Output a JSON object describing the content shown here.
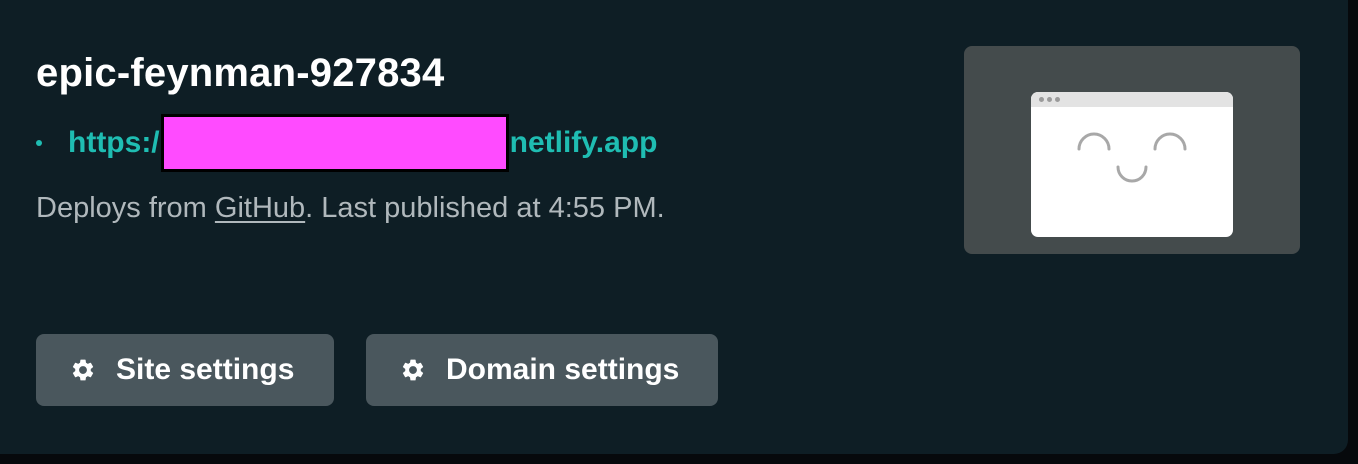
{
  "site": {
    "name": "epic-feynman-927834",
    "url_prefix": "https:/",
    "url_suffix": "netlify.app",
    "deploy_prefix": "Deploys from ",
    "deploy_source": "GitHub",
    "deploy_suffix": ". Last published at 4:55 PM."
  },
  "actions": {
    "site_settings_label": "Site settings",
    "domain_settings_label": "Domain settings"
  },
  "icons": {
    "bullet": "bullet-dot-icon",
    "redaction": "redaction-box",
    "gear": "gear-icon",
    "preview": "browser-smiley-preview"
  },
  "colors": {
    "card_background": "#0e1e25",
    "url_teal": "#1fbdb2",
    "redaction_magenta": "#ff4bff",
    "button_background": "#4a575d"
  }
}
